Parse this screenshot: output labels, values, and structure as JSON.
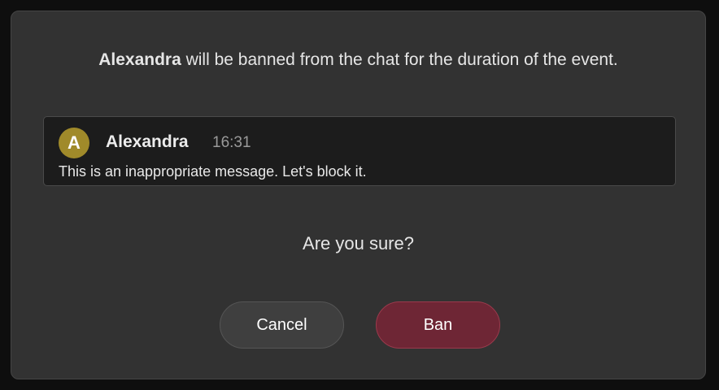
{
  "dialog": {
    "headline": {
      "name": "Alexandra",
      "text": " will be banned from the chat for the duration of the event."
    },
    "message": {
      "avatar_initial": "A",
      "author": "Alexandra",
      "time": "16:31",
      "text": "This is an inappropriate message. Let's block it."
    },
    "question": "Are you sure?",
    "buttons": {
      "cancel_label": "Cancel",
      "ban_label": "Ban"
    }
  },
  "colors": {
    "avatar": "#a08a2a",
    "ban_button": "#6e2635",
    "cancel_button": "#3f3f3f",
    "dialog_bg": "#323232"
  }
}
